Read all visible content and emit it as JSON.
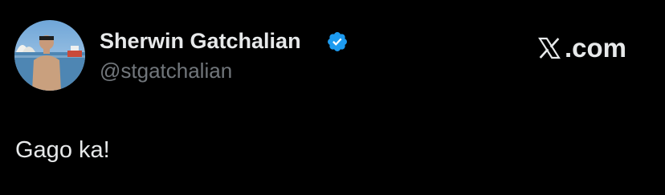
{
  "author": {
    "display_name": "Sherwin Gatchalian",
    "handle": "@stgatchalian",
    "verified": true,
    "avatar_icon": "profile-photo"
  },
  "brand": {
    "suffix": ".com",
    "icon": "x-logo-icon"
  },
  "tweet": {
    "text": "Gago ka!"
  },
  "colors": {
    "background": "#000000",
    "primary_text": "#e7e9ea",
    "secondary_text": "#71767b",
    "verified_badge": "#1d9bf0"
  }
}
